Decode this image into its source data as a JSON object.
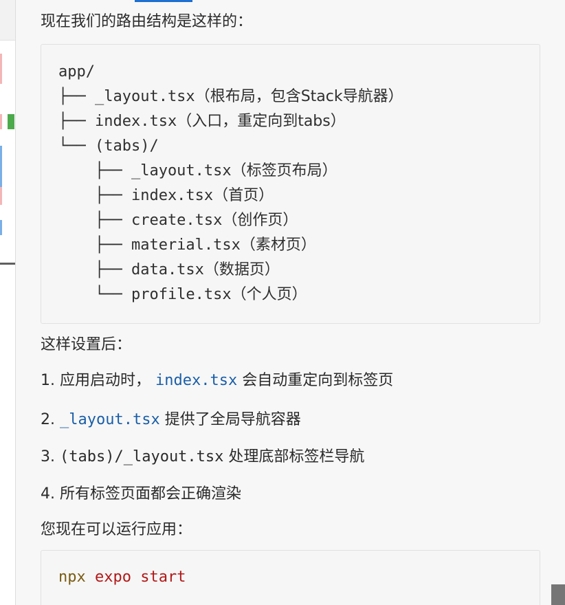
{
  "intro_text": "现在我们的路由结构是这样的：",
  "tree": [
    {
      "prefix": "app/",
      "desc": ""
    },
    {
      "prefix": "├── _layout.tsx",
      "desc": "（根布局，包含Stack导航器）"
    },
    {
      "prefix": "├── index.tsx",
      "desc": "（入口，重定向到tabs）"
    },
    {
      "prefix": "└── (tabs)/",
      "desc": ""
    },
    {
      "prefix": "    ├── _layout.tsx",
      "desc": "（标签页布局）"
    },
    {
      "prefix": "    ├── index.tsx",
      "desc": "（首页）"
    },
    {
      "prefix": "    ├── create.tsx",
      "desc": "（创作页）"
    },
    {
      "prefix": "    ├── material.tsx",
      "desc": "（素材页）"
    },
    {
      "prefix": "    ├── data.tsx",
      "desc": "（数据页）"
    },
    {
      "prefix": "    └── profile.tsx",
      "desc": "（个人页）"
    }
  ],
  "after_setup_text": "这样设置后：",
  "list": [
    {
      "num": "1.",
      "pre": "应用启动时，",
      "code": "index.tsx",
      "post": " 会自动重定向到标签页"
    },
    {
      "num": "2.",
      "pre": "",
      "code": "_layout.tsx",
      "post": " 提供了全局导航容器"
    },
    {
      "num": "3.",
      "pre": "",
      "code": "(tabs)/_layout.tsx",
      "post": " 处理底部标签栏导航"
    },
    {
      "num": "4.",
      "pre": "所有标签页面都会正确渲染",
      "code": "",
      "post": ""
    }
  ],
  "run_text": "您现在可以运行应用：",
  "command": {
    "cmd": "npx",
    "arg1": "expo",
    "arg2": "start"
  },
  "colors": {
    "code_link": "#1a5ea8",
    "cmd": "#7a5c12",
    "arg": "#b21818",
    "accent": "#1e6fd0"
  }
}
